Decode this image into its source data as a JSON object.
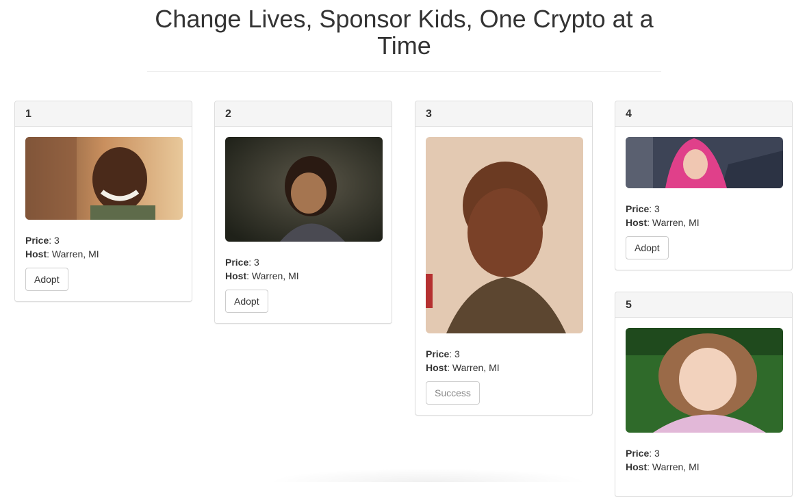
{
  "page": {
    "title": "Change Lives, Sponsor Kids, One Crypto at a Time"
  },
  "labels": {
    "price": "Price",
    "host": "Host"
  },
  "colors": {
    "panel_heading_bg": "#f5f5f5",
    "border": "#dddddd",
    "text": "#333333"
  },
  "cards": [
    {
      "number": "1",
      "price": "3",
      "host": "Warren, MI",
      "button_label": "Adopt",
      "button_state": "enabled",
      "photo": "smiling-child-photo"
    },
    {
      "number": "2",
      "price": "3",
      "host": "Warren, MI",
      "button_label": "Adopt",
      "button_state": "enabled",
      "photo": "girl-with-pigtails-photo"
    },
    {
      "number": "3",
      "price": "3",
      "host": "Warren, MI",
      "button_label": "Success",
      "button_state": "disabled",
      "photo": "boy-portrait-photo"
    },
    {
      "number": "4",
      "price": "3",
      "host": "Warren, MI",
      "button_label": "Adopt",
      "button_state": "enabled",
      "photo": "girl-in-pink-headscarf-photo"
    },
    {
      "number": "5",
      "price": "3",
      "host": "Warren, MI",
      "button_label": "",
      "button_state": "hidden",
      "photo": "girl-resting-on-hands-photo"
    }
  ]
}
